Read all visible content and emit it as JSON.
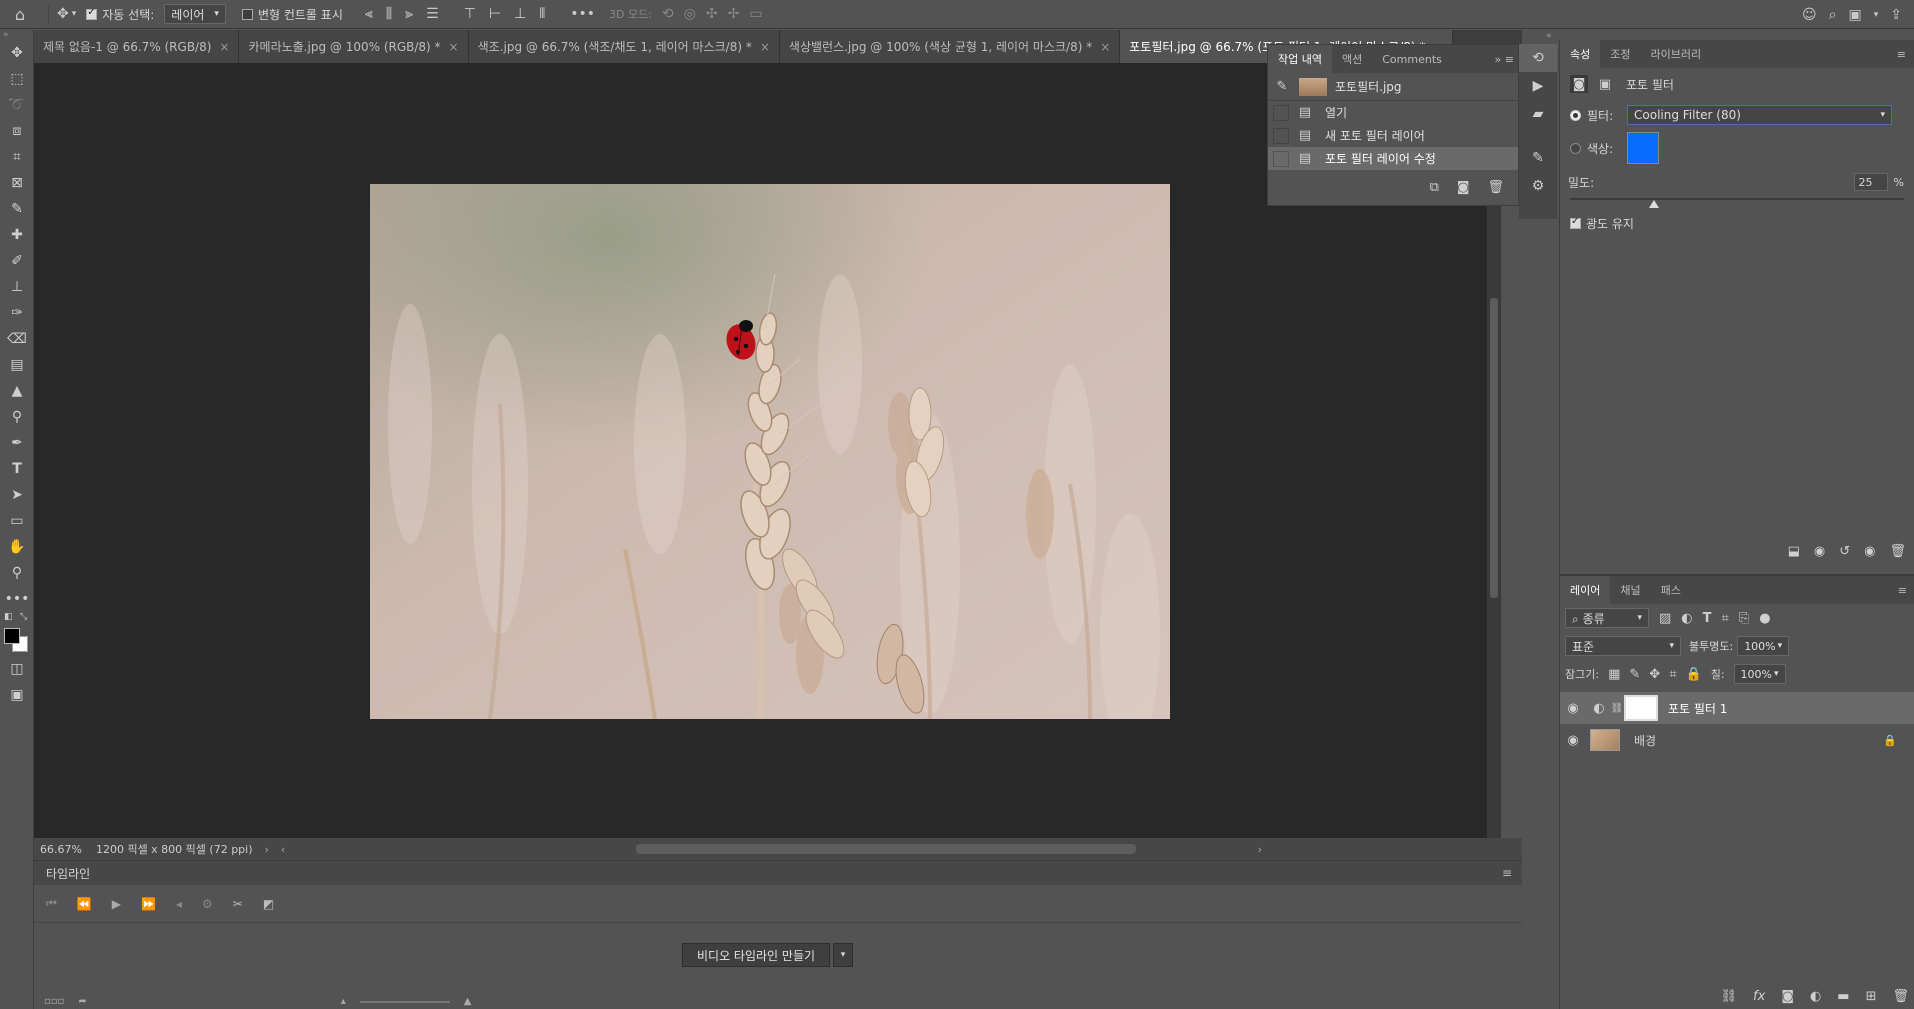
{
  "options_bar": {
    "auto_select_label": "자동 선택:",
    "auto_select_value": "레이어",
    "transform_controls_label": "변형 컨트롤 표시",
    "mode_3d_label": "3D 모드:"
  },
  "tabs": [
    {
      "label": "제목 없음-1 @ 66.7% (RGB/8)",
      "close": "×"
    },
    {
      "label": "카메라노출.jpg @ 100% (RGB/8) *",
      "close": "×"
    },
    {
      "label": "색조.jpg @ 66.7% (색조/채도 1, 레이어 마스크/8) *",
      "close": "×"
    },
    {
      "label": "색상밸런스.jpg @ 100% (색상 균형 1, 레이어 마스크/8) *",
      "close": "×"
    },
    {
      "label": "포토필터.jpg @ 66.7% (포토 필터 1, 레이어 마스크/8) *",
      "close": "×"
    }
  ],
  "status": {
    "zoom": "66.67%",
    "doc_info": "1200 픽셀 x 800 픽셀 (72 ppi)"
  },
  "timeline": {
    "title": "타임라인",
    "create_button": "비디오 타임라인 만들기"
  },
  "history": {
    "tabs": [
      "작업 내역",
      "액션",
      "Comments"
    ],
    "snapshot": "포토필터.jpg",
    "items": [
      "열기",
      "새 포토 필터 레이어",
      "포토 필터 레이어 수정"
    ]
  },
  "properties": {
    "tabs": [
      "속성",
      "조정",
      "라이브러리"
    ],
    "title": "포토 필터",
    "filter_label": "필터:",
    "filter_value": "Cooling Filter (80)",
    "color_label": "색상:",
    "color_swatch": "#0a6cff",
    "density_label": "밀도:",
    "density_value": "25",
    "density_unit": "%",
    "density_level": 0.25,
    "preserve_luminosity": "광도 유지"
  },
  "layers": {
    "tabs": [
      "레이어",
      "채널",
      "패스"
    ],
    "kind_filter": "종류",
    "blend_mode": "표준",
    "opacity_label": "불투명도:",
    "opacity_value": "100%",
    "lock_label": "잠그기:",
    "fill_label": "칠:",
    "fill_value": "100%",
    "items": [
      {
        "name": "포토 필터 1"
      },
      {
        "name": "배경"
      }
    ]
  }
}
